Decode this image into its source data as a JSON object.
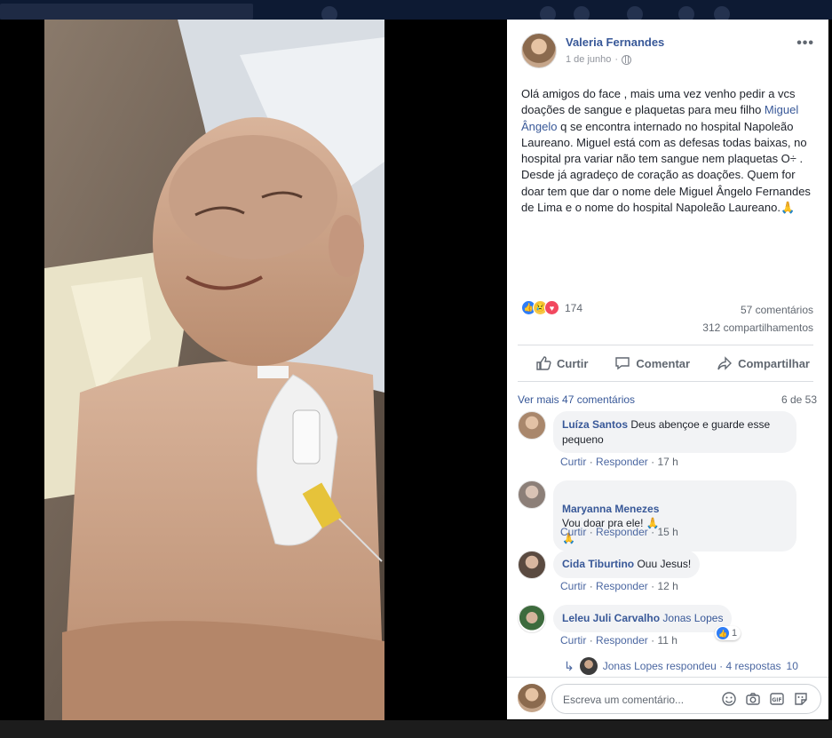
{
  "post": {
    "author": "Valeria Fernandes",
    "date": "1 de junho",
    "more_label": "•••",
    "text_1": "Olá amigos do face , mais uma vez venho pedir a vcs doações de sangue e plaquetas para meu filho ",
    "mention": "Miguel Ângelo",
    "text_2": " q se encontra internado no hospital Napoleão Laureano. Miguel está com as defesas todas baixas, no hospital pra variar não tem sangue nem plaquetas O÷ . Desde já agradeço de coração as doações. Quem for doar tem que dar o nome dele Miguel Ângelo Fernandes de Lima e o nome do hospital Napoleão Laureano.🙏"
  },
  "stats": {
    "reactions_count": "174",
    "comments_count": "57 comentários",
    "shares_count": "312 compartilhamentos"
  },
  "actions": {
    "like": "Curtir",
    "comment": "Comentar",
    "share": "Compartilhar"
  },
  "comments_header": {
    "see_more": "Ver mais 47 comentários",
    "page_count": "6 de 53"
  },
  "comment_actions": {
    "like": "Curtir",
    "reply": "Responder",
    "sep": "·"
  },
  "comments": [
    {
      "author": "Luíza Santos",
      "text": "Deus abençoe e guarde esse pequeno",
      "time": "17 h"
    },
    {
      "author": "Maryanna Menezes",
      "text": "Vou doar pra ele! 🙏\n🙏",
      "time": "15 h"
    },
    {
      "author": "Cida Tiburtino",
      "text": "Ouu Jesus!",
      "time": "12 h"
    },
    {
      "author": "Leleu Juli Carvalho",
      "tag": "Jonas Lopes",
      "time": "11 h",
      "reaction_count": "1"
    }
  ],
  "reply_summary": {
    "text": "Jonas Lopes respondeu · 4 respostas",
    "trailing": "10"
  },
  "composer": {
    "placeholder": "Escreva um comentário..."
  },
  "colors": {
    "link": "#385898",
    "like_blue": "#2e7df6",
    "love_red": "#f2485f",
    "bubble_bg": "#f2f3f5"
  }
}
